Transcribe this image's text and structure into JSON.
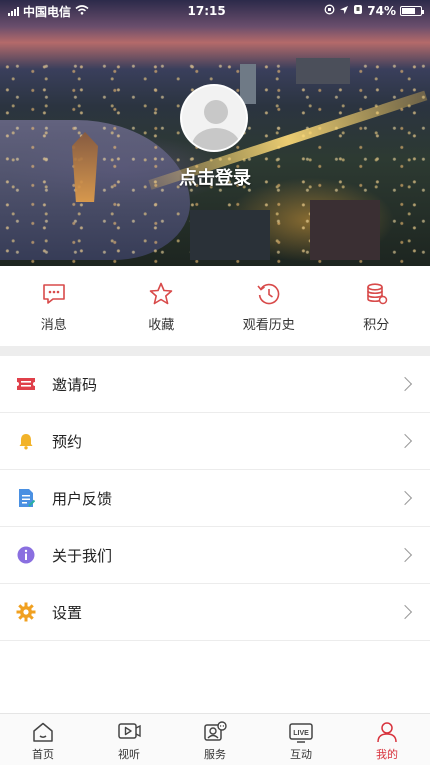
{
  "status_bar": {
    "carrier": "中国电信",
    "time": "17:15",
    "battery": "74%",
    "battery_level": 0.74
  },
  "profile": {
    "login_text": "点击登录",
    "avatar_icon": "default-avatar-icon"
  },
  "quick_actions": [
    {
      "label": "消息",
      "icon": "message-icon"
    },
    {
      "label": "收藏",
      "icon": "star-icon"
    },
    {
      "label": "观看历史",
      "icon": "history-icon"
    },
    {
      "label": "积分",
      "icon": "points-icon"
    }
  ],
  "menu": [
    {
      "label": "邀请码",
      "icon": "ticket-icon",
      "color": "#e0404a"
    },
    {
      "label": "预约",
      "icon": "bell-icon",
      "color": "#f2b32a"
    },
    {
      "label": "用户反馈",
      "icon": "feedback-icon",
      "color": "#4a90e2"
    },
    {
      "label": "关于我们",
      "icon": "info-icon",
      "color": "#8a6fe0"
    },
    {
      "label": "设置",
      "icon": "gear-icon",
      "color": "#f0a020"
    }
  ],
  "tabbar": [
    {
      "label": "首页",
      "icon": "home-icon",
      "active": false
    },
    {
      "label": "视听",
      "icon": "video-icon",
      "active": false
    },
    {
      "label": "服务",
      "icon": "service-icon",
      "active": false
    },
    {
      "label": "互动",
      "icon": "live-icon",
      "active": false
    },
    {
      "label": "我的",
      "icon": "user-icon",
      "active": true
    }
  ],
  "colors": {
    "accent": "#d8323c",
    "quick_icon": "#d84a4a"
  }
}
